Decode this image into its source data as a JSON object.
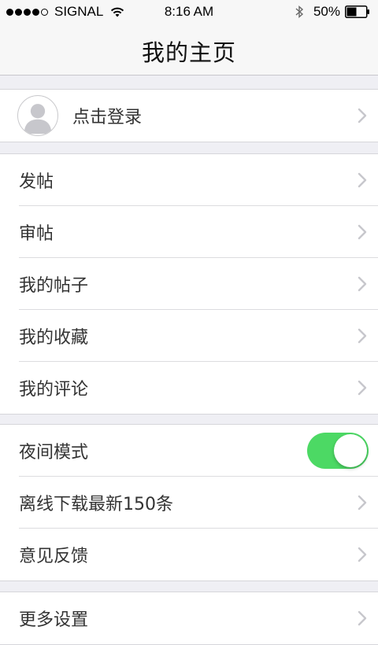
{
  "status_bar": {
    "carrier": "SIGNAL",
    "time": "8:16 AM",
    "battery": "50%",
    "signal_bars_filled": 4,
    "signal_bars_total": 5
  },
  "nav": {
    "title": "我的主页"
  },
  "login": {
    "label": "点击登录"
  },
  "menu_group_1": [
    {
      "label": "发帖"
    },
    {
      "label": "审帖"
    },
    {
      "label": "我的帖子"
    },
    {
      "label": "我的收藏"
    },
    {
      "label": "我的评论"
    }
  ],
  "menu_group_2": {
    "night_mode": {
      "label": "夜间模式",
      "enabled": true
    },
    "offline_download": {
      "label": "离线下载最新150条"
    },
    "feedback": {
      "label": "意见反馈"
    }
  },
  "menu_group_3": [
    {
      "label": "更多设置"
    }
  ],
  "colors": {
    "toggle_on": "#4cd964",
    "background": "#efeff4",
    "chevron": "#c7c7cc"
  },
  "icons": {
    "status": [
      "signal-dots-icon",
      "wifi-icon",
      "bluetooth-icon",
      "battery-icon"
    ],
    "rows": "chevron-right-icon",
    "avatar": "user-silhouette-icon"
  }
}
